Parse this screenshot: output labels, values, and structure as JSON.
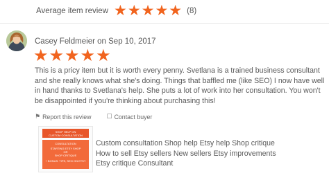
{
  "summary": {
    "label": "Average item review",
    "rating": 5,
    "max_rating": 5,
    "count": "(8)"
  },
  "review": {
    "reviewer": "Casey Feldmeier",
    "on": "on",
    "date": "Sep 10, 2017",
    "rating": 5,
    "max_rating": 5,
    "text": "This is a pricy item but it is worth every penny. Svetlana is a trained business consultant and she really knows what she's doing. Things that baffled me (like SEO) I now have well in hand thanks to Svetlana's help. She puts a lot of work into her consultation. You won't be disappointed if you're thinking about purchasing this!",
    "report_label": "Report this review",
    "contact_label": "Contact buyer"
  },
  "item": {
    "title": "Custom consultation Shop help Etsy help Shop critique How to sell Etsy sellers New sellers Etsy improvements Etsy critique Consultant",
    "thumbnail_lines": [
      "SHOP HELP ON",
      "CUSTOM CONSULTATION",
      "CONSULTATION",
      "STARTING ETSY SHOP",
      "OR",
      "SHOP CRITIQUE",
      "+ BONUS: TIPS, SEO ON ETSY"
    ]
  },
  "colors": {
    "star": "#f1641e",
    "thumbnail_accent": "#e8562a"
  }
}
